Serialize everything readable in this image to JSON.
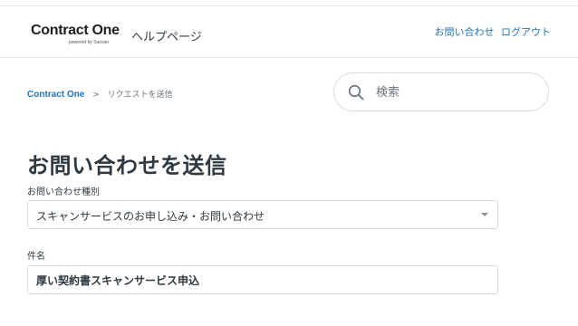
{
  "header": {
    "logo_text": "Contract One",
    "logo_tagline": "powered by Sansan",
    "help_title": "ヘルプページ",
    "links": [
      {
        "label": "お問い合わせ"
      },
      {
        "label": "ログアウト"
      }
    ]
  },
  "breadcrumb": {
    "home": "Contract One",
    "separator": ">",
    "current": "リクエストを送信"
  },
  "search": {
    "placeholder": "検索",
    "icon": "search-icon"
  },
  "page": {
    "title": "お問い合わせを送信"
  },
  "form": {
    "category": {
      "label": "お問い合わせ種別",
      "value": "スキャンサービスのお申し込み・お問い合わせ"
    },
    "subject": {
      "label": "件名",
      "value": "厚い契約書スキャンサービス申込"
    }
  },
  "colors": {
    "link": "#1f73b7",
    "text": "#2f3941",
    "border": "#d8dcde",
    "logo_accent": "#e4002b"
  }
}
